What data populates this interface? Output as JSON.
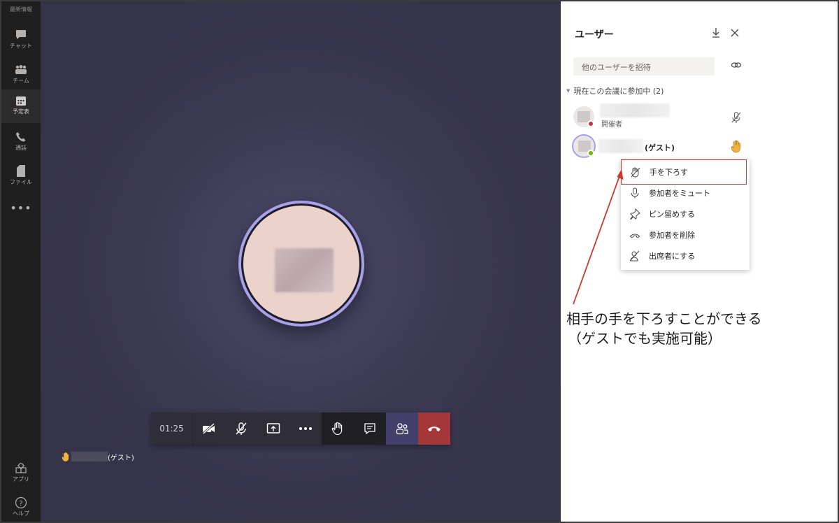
{
  "rail": {
    "top_label": "最新情報",
    "items": [
      {
        "label": "チャット",
        "icon": "chat-icon"
      },
      {
        "label": "チーム",
        "icon": "teams-icon"
      },
      {
        "label": "予定表",
        "icon": "calendar-icon"
      },
      {
        "label": "通話",
        "icon": "phone-icon"
      },
      {
        "label": "ファイル",
        "icon": "file-icon"
      }
    ],
    "more": "•••",
    "apps_label": "アプリ",
    "help_label": "ヘルプ"
  },
  "call": {
    "timer": "01:25",
    "guest_name_suffix": "(ゲスト)",
    "toolbar_buttons": [
      "camera-off-icon",
      "mic-off-icon",
      "share-screen-icon",
      "more-icon",
      "raise-hand-icon",
      "chat-icon",
      "participants-icon",
      "hang-up-icon"
    ]
  },
  "panel": {
    "title": "ユーザー",
    "invite_placeholder": "他のユーザーを招待",
    "section_label": "現在この会議に参加中 (2)",
    "participants": [
      {
        "role": "開催者",
        "status_color": "#c4314b"
      },
      {
        "name_suffix": "(ゲスト)",
        "status_color": "#6bb700"
      }
    ],
    "menu": [
      {
        "label": "手を下ろす",
        "icon": "lower-hand-icon",
        "highlighted": true
      },
      {
        "label": "参加者をミュート",
        "icon": "mic-icon"
      },
      {
        "label": "ピン留めする",
        "icon": "pin-icon"
      },
      {
        "label": "参加者を削除",
        "icon": "remove-participant-icon"
      },
      {
        "label": "出席者にする",
        "icon": "attendee-icon"
      }
    ]
  },
  "annotation": {
    "line1": "相手の手を下ろすことができる",
    "line2": "（ゲストでも実施可能）",
    "color": "#c83a2f"
  }
}
